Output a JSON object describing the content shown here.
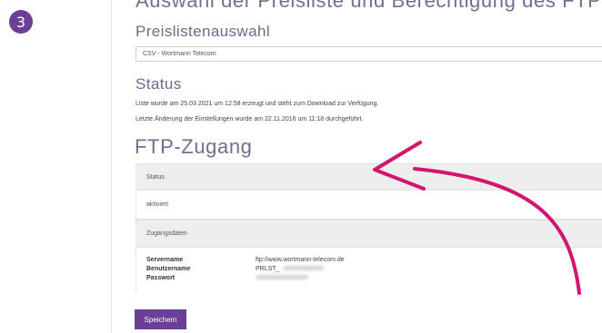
{
  "step": {
    "number": "3"
  },
  "header": {
    "cut_title": "Auswahl der Preisliste und Berechtigung des FTP-Zugangs"
  },
  "pricelist": {
    "title": "Preislistenauswahl",
    "selected": "CSV - Wortmann Telecom"
  },
  "status": {
    "title": "Status",
    "line1": "Liste wurde am 25.03.2021 um 12:58 erzeugt und steht zum Download zur Verfügung.",
    "line2": "Letzte Änderung der Einstellungen wurde am 22.11.2016 um 11:18 durchgeführt."
  },
  "ftp": {
    "title": "FTP-Zugang",
    "status_header": "Status",
    "status_value": "aktiviert",
    "credentials_header": "Zugangsdaten",
    "rows": [
      {
        "label": "Servername",
        "value": "ftp://www.wortmann-telecom.de"
      },
      {
        "label": "Benutzername",
        "value": "PRLST_"
      },
      {
        "label": "Passwort",
        "value": ""
      }
    ]
  },
  "actions": {
    "save_label": "Speichern"
  },
  "colors": {
    "accent": "#6b3f95",
    "arrow": "#d4146e",
    "heading": "#7a6b8f"
  }
}
